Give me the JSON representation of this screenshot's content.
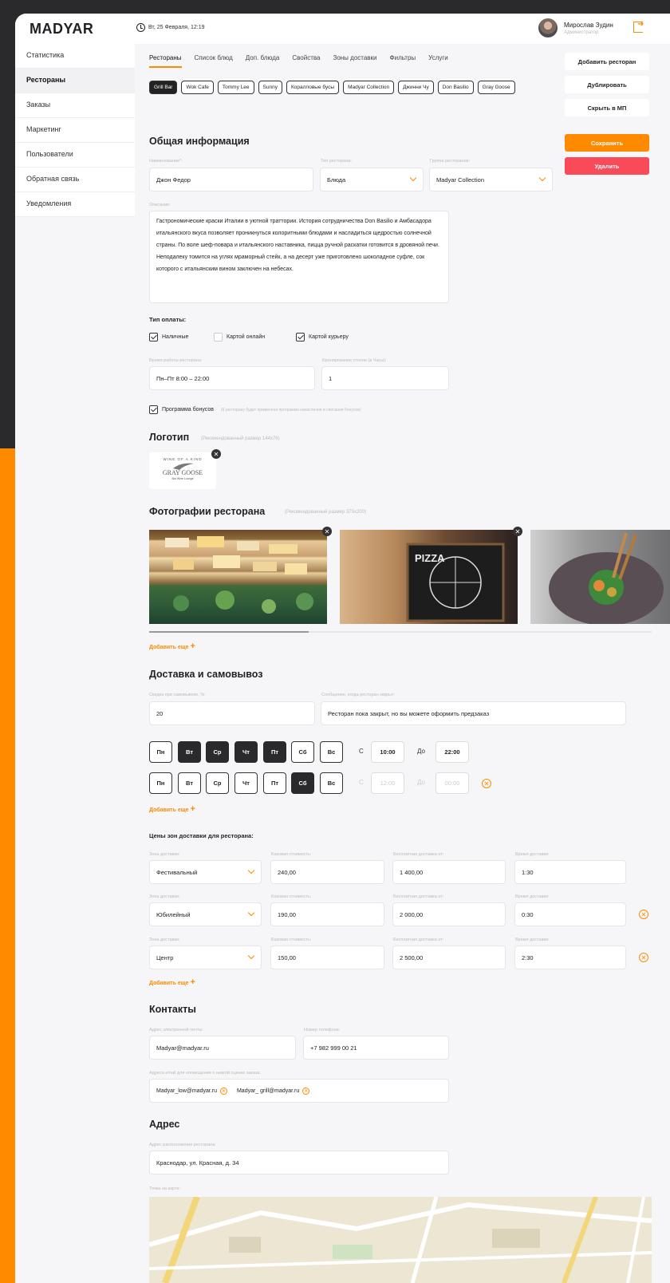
{
  "app": {
    "logo": "MADYAR",
    "date": "Вт, 25 Февраля, 12:19"
  },
  "user": {
    "name": "Мирослав Зудин",
    "role": "Администратор"
  },
  "sidebar": {
    "items": [
      "Статистика",
      "Рестораны",
      "Заказы",
      "Маркетинг",
      "Пользователи",
      "Обратная связь",
      "Уведомления"
    ],
    "active_index": 1
  },
  "tabs": {
    "items": [
      "Рестораны",
      "Список блюд",
      "Доп. блюда",
      "Свойства",
      "Зоны доставки",
      "Фильтры",
      "Услуги"
    ],
    "active_index": 0
  },
  "side_buttons": {
    "add": "Добавить ресторан",
    "duplicate": "Дублировать",
    "hide": "Скрыть в МП",
    "save": "Сохранить",
    "delete": "Удалить"
  },
  "restaurants": {
    "items": [
      "Grill Bar",
      "Wok Cafe",
      "Tommy Lee",
      "Sunny",
      "Коралловые бусы",
      "Madyar Collection",
      "Джинни Чу",
      "Don Basilio",
      "Gray Goose"
    ],
    "selected_index": 0
  },
  "general": {
    "title": "Общая информация",
    "name_label": "Наименование*:",
    "name_value": "Джон Федор",
    "type_label": "Тип ресторана:",
    "type_value": "Блюда",
    "group_label": "Группа ресторанов:",
    "group_value": "Madyar Collection",
    "desc_label": "Описание:",
    "description": "Гастрономические краски Италии в уютной траттории. История сотрудничества Don Basilio и Амбасадора итальянского вкуса позволяет проникнуться колоритными блюдами и насладиться щедростью солнечной страны. По воле шеф-повара и итальянского наставника, пицца ручной раскатки готовится в дровяной печи. Неподалеку томится на углях мраморный стейк, а на десерт уже приготовлено шоколадное суфле, сок которого с итальянским вином заключен на небесах.",
    "pay_title": "Тип оплаты:",
    "pay": [
      {
        "label": "Наличные",
        "checked": true
      },
      {
        "label": "Картой онлайн",
        "checked": false
      },
      {
        "label": "Картой курьеру",
        "checked": true
      }
    ],
    "hours_label": "Время работы ресторана:",
    "hours_value": "Пн–Пт 8:00 – 22:00",
    "booking_label": "Бронирование столов (в Часы):",
    "booking_value": "1",
    "bonus_label": "Программа бонусов",
    "bonus_hint": "(К ресторану будет применена программа начисления и списания бонусов)",
    "bonus_checked": true
  },
  "logo_section": {
    "title": "Логотип",
    "hint": "(Рекомендованный размер 144x76)",
    "logo_text_top": "WINE OF A KIND",
    "logo_text_main": "GRAY GOOSE",
    "logo_text_sub": "Bar Wine Lounge"
  },
  "photos": {
    "title": "Фотографии ресторана",
    "hint": "(Рекомендованный размер 375х200)",
    "add_more": "Добавить еще",
    "sign_text": "PIZZA"
  },
  "delivery": {
    "title": "Доставка и самовывоз",
    "discount_label": "Скидка при самовывозе, %:",
    "discount_value": "20",
    "closed_label": "Сообщение, когда ресторан закрыт:",
    "closed_value": "Ресторан пока закрыт, но вы можете оформить предзаказ",
    "days": [
      "Пн",
      "Вт",
      "Ср",
      "Чт",
      "Пт",
      "Сб",
      "Вс"
    ],
    "rows": [
      {
        "active": [
          false,
          true,
          true,
          true,
          true,
          false,
          false
        ],
        "from": "10:00",
        "to": "22:00",
        "from_label": "С",
        "to_label": "До"
      },
      {
        "active": [
          false,
          false,
          false,
          false,
          false,
          true,
          false
        ],
        "from": "12:00",
        "to": "00:00",
        "from_label": "С",
        "to_label": "До"
      }
    ],
    "add_more": "Добавить еще",
    "zones_title": "Цены зон доставки для ресторана:",
    "zone_label": "Зона доставки:",
    "base_label": "Базовая стоимость:",
    "free_label": "Бесплатная доставка от:",
    "time_label": "Время доставки:",
    "zones": [
      {
        "zone": "Фестивальный",
        "base": "240,00",
        "free": "1 400,00",
        "time": "1:30"
      },
      {
        "zone": "Юбилейный",
        "base": "190,00",
        "free": "2 000,00",
        "time": "0:30"
      },
      {
        "zone": "Центр",
        "base": "150,00",
        "free": "2 500,00",
        "time": "2:30"
      }
    ],
    "zones_add": "Добавить еще"
  },
  "contacts": {
    "title": "Контакты",
    "email_label": "Адрес электронной почты:",
    "email_value": "Madyar@madyar.ru",
    "phone_label": "Номер телефона:",
    "phone_value": "+7 982 999 00 21",
    "notify_label": "Адреса email для оповещения о низкой оценке заказа:",
    "notify": [
      "Madyar_low@madyar.ru",
      "Madyar_ grill@madyar.ru"
    ]
  },
  "address": {
    "title": "Адрес",
    "label": "Адрес расположения ресторана:",
    "value": "Краснодар, ул. Красная, д. 34",
    "map_label": "Точка на карте:"
  },
  "colors": {
    "accent": "#ff8a00",
    "danger": "#f94a5a",
    "dark": "#2a2a2c"
  }
}
